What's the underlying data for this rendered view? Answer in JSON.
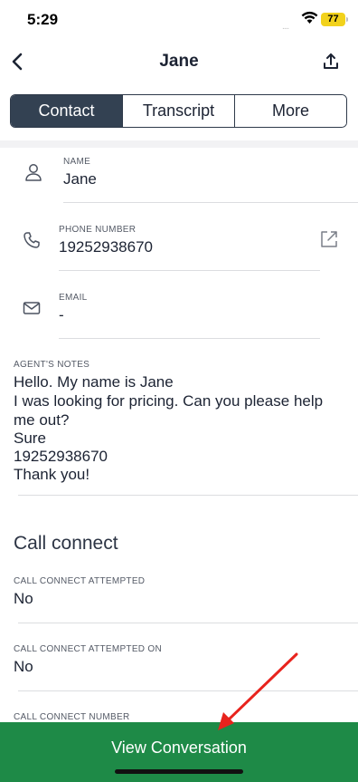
{
  "status_bar": {
    "time": "5:29",
    "signal": "....",
    "battery": "77"
  },
  "nav": {
    "title": "Jane"
  },
  "tabs": [
    {
      "label": "Contact",
      "active": true
    },
    {
      "label": "Transcript",
      "active": false
    },
    {
      "label": "More",
      "active": false
    }
  ],
  "contact": {
    "name": {
      "label": "NAME",
      "value": "Jane"
    },
    "phone": {
      "label": "PHONE NUMBER",
      "value": "19252938670"
    },
    "email": {
      "label": "EMAIL",
      "value": "-"
    }
  },
  "notes": {
    "label": "AGENT'S NOTES",
    "lines": [
      "Hello. My name is Jane",
      "I was looking for pricing. Can you please help",
      "me out?",
      "Sure",
      "19252938670",
      "Thank you!"
    ]
  },
  "call_connect": {
    "title": "Call connect",
    "attempted": {
      "label": "CALL CONNECT ATTEMPTED",
      "value": "No"
    },
    "attempted_on": {
      "label": "CALL CONNECT ATTEMPTED ON",
      "value": "No"
    },
    "number": {
      "label": "CALL CONNECT NUMBER"
    }
  },
  "footer": {
    "button_label": "View Conversation"
  },
  "colors": {
    "accent_green": "#1e8a47",
    "segment_active": "#334152",
    "battery": "#f2d21c",
    "annotation": "#e8231d"
  }
}
